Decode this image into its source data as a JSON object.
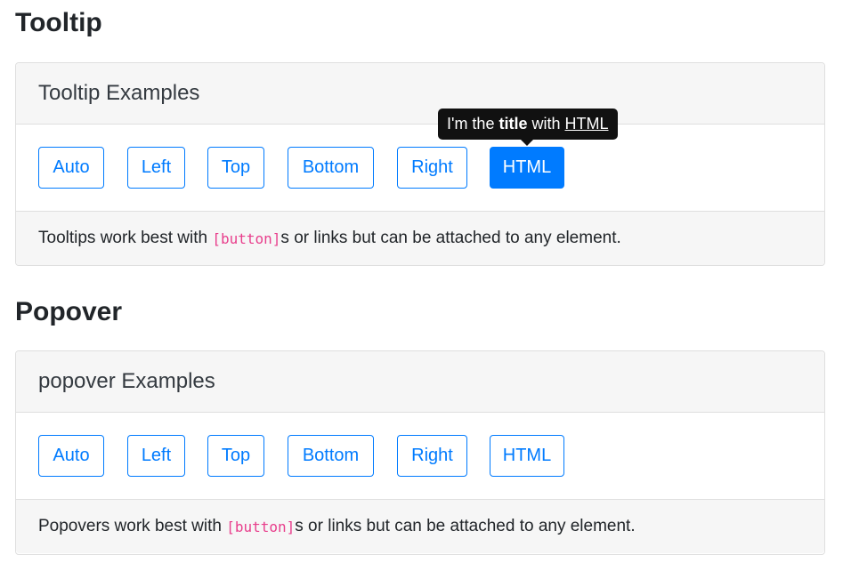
{
  "tooltip_section": {
    "title": "Tooltip",
    "card_header": "Tooltip Examples",
    "buttons": {
      "auto": "Auto",
      "left": "Left",
      "top": "Top",
      "bottom": "Bottom",
      "right": "Right",
      "html": "HTML"
    },
    "active_button": "HTML",
    "tooltip": {
      "prefix": "I'm the ",
      "bold": "title",
      "middle": " with ",
      "underlined": "HTML"
    },
    "footer": {
      "before": "Tooltips work best with ",
      "code": "[button]",
      "after": "s or links but can be attached to any element."
    }
  },
  "popover_section": {
    "title": "Popover",
    "card_header": "popover Examples",
    "buttons": {
      "auto": "Auto",
      "left": "Left",
      "top": "Top",
      "bottom": "Bottom",
      "right": "Right",
      "html": "HTML"
    },
    "footer": {
      "before": "Popovers work best with ",
      "code": "[button]",
      "after": "s or links but can be attached to any element."
    }
  },
  "colors": {
    "primary": "#007bff",
    "code": "#e83e8c",
    "tooltip_bg": "#111111",
    "card_header_bg": "#f6f6f6"
  }
}
